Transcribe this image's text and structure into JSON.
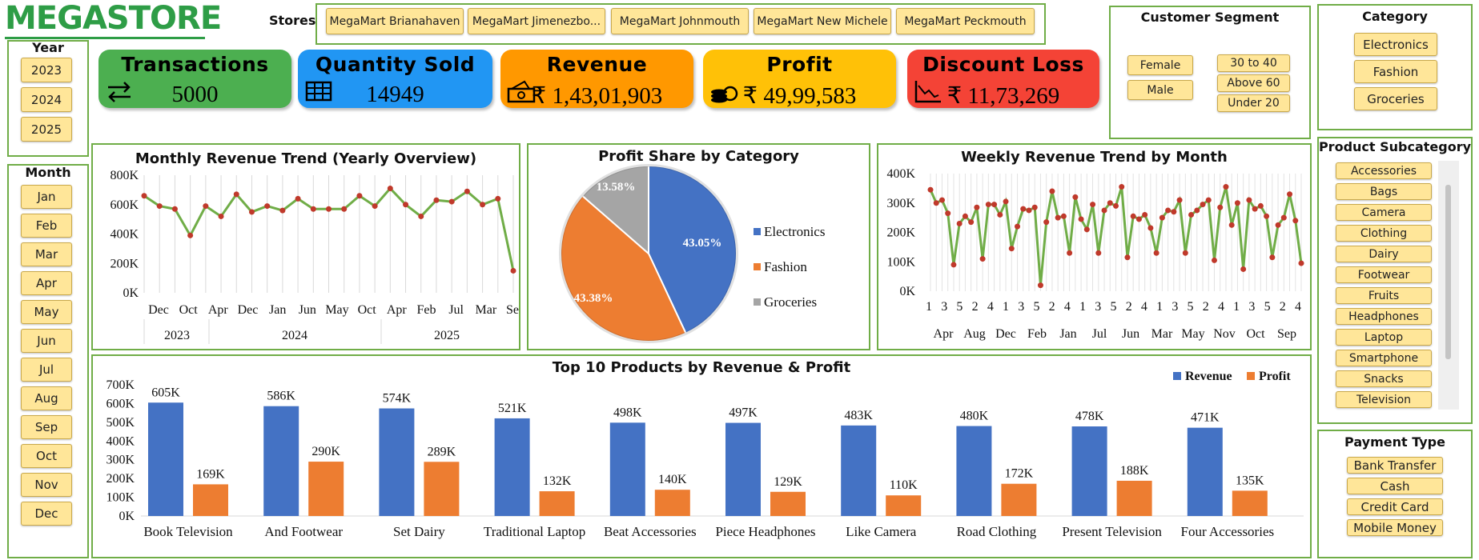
{
  "logo": {
    "text": "MegaStore"
  },
  "stores": {
    "label": "Stores",
    "items": [
      "MegaMart Brianahaven",
      "MegaMart Jimenezbo...",
      "MegaMart Johnmouth",
      "MegaMart New Michele",
      "MegaMart Peckmouth"
    ]
  },
  "year_slicer": {
    "title": "Year",
    "items": [
      "2023",
      "2024",
      "2025"
    ]
  },
  "month_slicer": {
    "title": "Month",
    "items": [
      "Jan",
      "Feb",
      "Mar",
      "Apr",
      "May",
      "Jun",
      "Jul",
      "Aug",
      "Sep",
      "Oct",
      "Nov",
      "Dec"
    ]
  },
  "kpis": [
    {
      "title": "Transactions",
      "value": "5000",
      "color": "#4caf50",
      "icon": "transfer-arrows-icon"
    },
    {
      "title": "Quantity Sold",
      "value": "14949",
      "color": "#2196f3",
      "icon": "table-grid-icon"
    },
    {
      "title": "Revenue",
      "value": "₹ 1,43,01,903",
      "color": "#ff9800",
      "icon": "cash-icon"
    },
    {
      "title": "Profit",
      "value": "₹ 49,99,583",
      "color": "#ffc107",
      "icon": "coins-icon"
    },
    {
      "title": "Discount Loss",
      "value": "₹ 11,73,269",
      "color": "#f44336",
      "icon": "declining-chart-icon"
    }
  ],
  "customer_segment": {
    "title": "Customer Segment",
    "gender": [
      "Female",
      "Male"
    ],
    "age": [
      "30 to 40",
      "Above 60",
      "Under 20"
    ]
  },
  "category_slicer": {
    "title": "Category",
    "items": [
      "Electronics",
      "Fashion",
      "Groceries"
    ]
  },
  "subcategory_slicer": {
    "title": "Product Subcategory",
    "items": [
      "Accessories",
      "Bags",
      "Camera",
      "Clothing",
      "Dairy",
      "Footwear",
      "Fruits",
      "Headphones",
      "Laptop",
      "Smartphone",
      "Snacks",
      "Television"
    ]
  },
  "payment_slicer": {
    "title": "Payment Type",
    "items": [
      "Bank Transfer",
      "Cash",
      "Credit Card",
      "Mobile Money"
    ]
  },
  "chart_data": [
    {
      "type": "line",
      "title": "Monthly Revenue Trend (Yearly Overview)",
      "x_tick_labels": [
        "Dec",
        "Oct",
        "Apr",
        "Dec",
        "Jan",
        "Jun",
        "May",
        "Oct",
        "Apr",
        "Feb",
        "Jul",
        "Mar",
        "Sep"
      ],
      "year_labels": [
        "2023",
        "2024",
        "2025"
      ],
      "y_tick_labels": [
        "0K",
        "200K",
        "400K",
        "600K",
        "800K"
      ],
      "ylim": [
        0,
        800000
      ],
      "values": [
        660000,
        590000,
        570000,
        390000,
        590000,
        520000,
        670000,
        550000,
        590000,
        560000,
        640000,
        570000,
        570000,
        570000,
        660000,
        590000,
        710000,
        600000,
        520000,
        630000,
        620000,
        690000,
        600000,
        640000,
        150000
      ],
      "color": "#70ad47",
      "marker_color": "#c0392b"
    },
    {
      "type": "pie",
      "title": "Profit Share by Category",
      "labels": [
        "Electronics",
        "Fashion",
        "Groceries"
      ],
      "values": [
        43.05,
        43.38,
        13.58
      ],
      "value_labels": [
        "43.05%",
        "43.38%",
        "13.58%"
      ],
      "colors": [
        "#4472c4",
        "#ed7d31",
        "#a5a5a5"
      ],
      "legend": "right"
    },
    {
      "type": "line",
      "title": "Weekly Revenue Trend by Month",
      "x_tick_labels": [
        "1",
        "3",
        "5",
        "2",
        "4",
        "1",
        "3",
        "5",
        "2",
        "4",
        "1",
        "3",
        "5",
        "2",
        "4",
        "1",
        "3",
        "5",
        "2",
        "4",
        "1",
        "3",
        "5",
        "2",
        "4"
      ],
      "month_labels": [
        "Apr",
        "Aug",
        "Dec",
        "Feb",
        "Jan",
        "Jul",
        "Jun",
        "Mar",
        "May",
        "Nov",
        "Oct",
        "Sep"
      ],
      "y_tick_labels": [
        "0K",
        "100K",
        "200K",
        "300K",
        "400K"
      ],
      "ylim": [
        0,
        400000
      ],
      "values": [
        345000,
        300000,
        310000,
        265000,
        90000,
        230000,
        255000,
        235000,
        285000,
        110000,
        295000,
        295000,
        260000,
        305000,
        145000,
        220000,
        280000,
        275000,
        285000,
        20000,
        235000,
        340000,
        250000,
        255000,
        130000,
        320000,
        245000,
        210000,
        295000,
        130000,
        275000,
        300000,
        290000,
        355000,
        115000,
        255000,
        245000,
        260000,
        215000,
        130000,
        250000,
        275000,
        270000,
        310000,
        130000,
        260000,
        275000,
        295000,
        310000,
        105000,
        285000,
        355000,
        225000,
        300000,
        75000,
        310000,
        280000,
        290000,
        255000,
        115000,
        225000,
        250000,
        330000,
        240000,
        95000
      ],
      "color": "#70ad47",
      "marker_color": "#c0392b"
    },
    {
      "type": "bar",
      "title": "Top 10 Products by Revenue & Profit",
      "categories": [
        "Book Television",
        "And Footwear",
        "Set Dairy",
        "Traditional Laptop",
        "Beat Accessories",
        "Piece Headphones",
        "Like Camera",
        "Road Clothing",
        "Present Television",
        "Four Accessories"
      ],
      "series": [
        {
          "name": "Revenue",
          "values": [
            605,
            586,
            574,
            521,
            498,
            497,
            483,
            480,
            478,
            471
          ],
          "labels": [
            "605K",
            "586K",
            "574K",
            "521K",
            "498K",
            "497K",
            "483K",
            "480K",
            "478K",
            "471K"
          ],
          "color": "#4472c4"
        },
        {
          "name": "Profit",
          "values": [
            169,
            290,
            289,
            132,
            140,
            129,
            110,
            172,
            188,
            135
          ],
          "labels": [
            "169K",
            "290K",
            "289K",
            "132K",
            "140K",
            "129K",
            "110K",
            "172K",
            "188K",
            "135K"
          ],
          "color": "#ed7d31"
        }
      ],
      "y_tick_labels": [
        "0K",
        "100K",
        "200K",
        "300K",
        "400K",
        "500K",
        "600K",
        "700K"
      ],
      "ylim": [
        0,
        700
      ],
      "legend": "top-right"
    }
  ]
}
